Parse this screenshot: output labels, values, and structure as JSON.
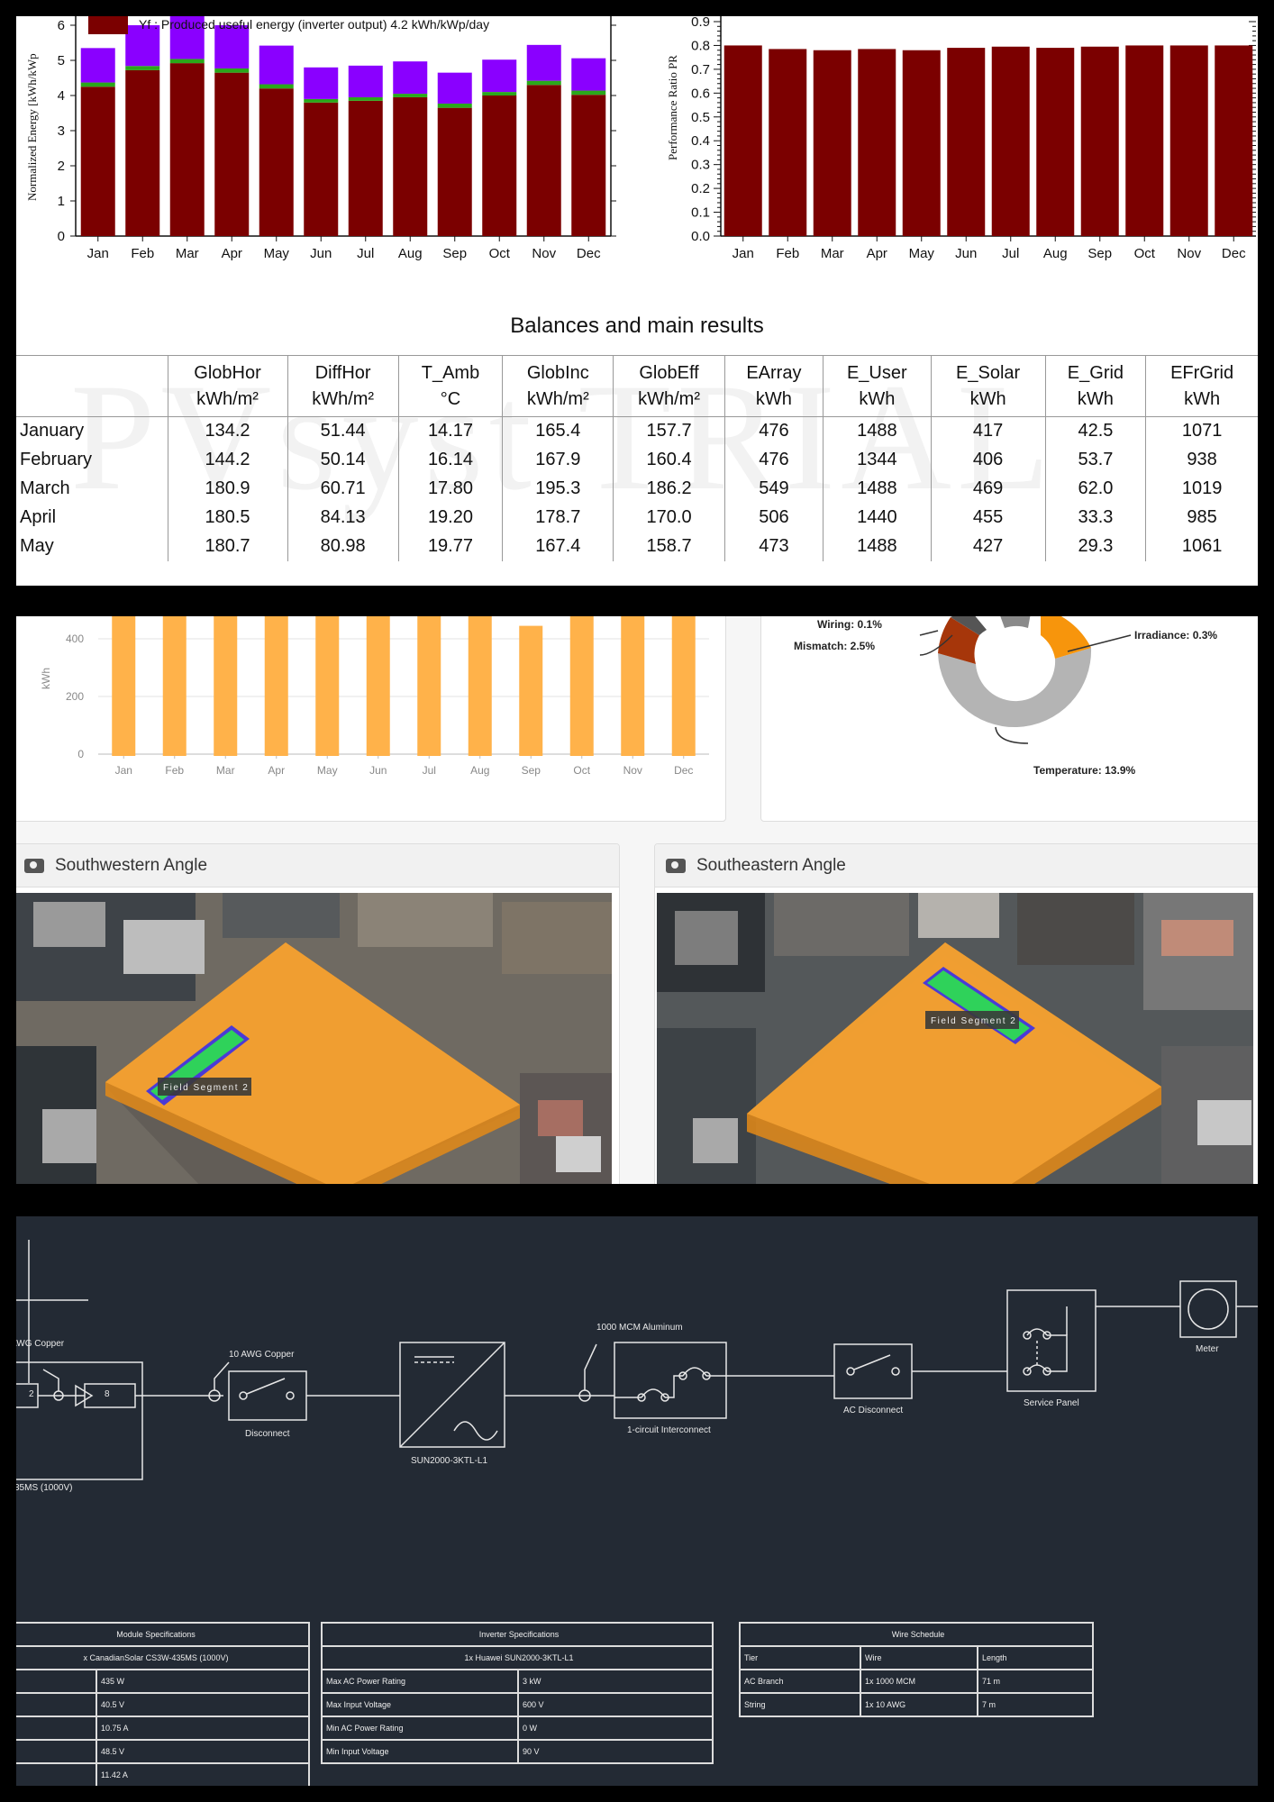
{
  "report": {
    "energy_chart": {
      "ylabel": "Normalized Energy [kWh/kWp",
      "legend_text": "Yf : Produced useful energy  (inverter output)  4.2 kWh/kWp/day",
      "months": [
        "Jan",
        "Feb",
        "Mar",
        "Apr",
        "May",
        "Jun",
        "Jul",
        "Aug",
        "Sep",
        "Oct",
        "Nov",
        "Dec"
      ],
      "y_ticks": [
        "0",
        "1",
        "2",
        "3",
        "4",
        "5",
        "6"
      ]
    },
    "pr_chart": {
      "ylabel": "Performance Ratio PR",
      "y_ticks": [
        "0.0",
        "0.1",
        "0.2",
        "0.3",
        "0.4",
        "0.5",
        "0.6",
        "0.7",
        "0.8",
        "0.9"
      ]
    },
    "table_title": "Balances and main results",
    "watermark": "PVsyst TRIAL",
    "columns": [
      "GlobHor",
      "DiffHor",
      "T_Amb",
      "GlobInc",
      "GlobEff",
      "EArray",
      "E_User",
      "E_Solar",
      "E_Grid",
      "EFrGrid"
    ],
    "units": [
      "kWh/m²",
      "kWh/m²",
      "°C",
      "kWh/m²",
      "kWh/m²",
      "kWh",
      "kWh",
      "kWh",
      "kWh",
      "kWh"
    ],
    "rows": [
      {
        "month": "January",
        "vals": [
          "134.2",
          "51.44",
          "14.17",
          "165.4",
          "157.7",
          "476",
          "1488",
          "417",
          "42.5",
          "1071"
        ]
      },
      {
        "month": "February",
        "vals": [
          "144.2",
          "50.14",
          "16.14",
          "167.9",
          "160.4",
          "476",
          "1344",
          "406",
          "53.7",
          "938"
        ]
      },
      {
        "month": "March",
        "vals": [
          "180.9",
          "60.71",
          "17.80",
          "195.3",
          "186.2",
          "549",
          "1488",
          "469",
          "62.0",
          "1019"
        ]
      },
      {
        "month": "April",
        "vals": [
          "180.5",
          "84.13",
          "19.20",
          "178.7",
          "170.0",
          "506",
          "1440",
          "455",
          "33.3",
          "985"
        ]
      },
      {
        "month": "May",
        "vals": [
          "180.7",
          "80.98",
          "19.77",
          "167.4",
          "158.7",
          "473",
          "1488",
          "427",
          "29.3",
          "1061"
        ]
      }
    ]
  },
  "chart_data": [
    {
      "type": "bar",
      "ylabel": "Normalized Energy [kWh/kWp",
      "categories": [
        "Jan",
        "Feb",
        "Mar",
        "Apr",
        "May",
        "Jun",
        "Jul",
        "Aug",
        "Sep",
        "Oct",
        "Nov",
        "Dec"
      ],
      "series": [
        {
          "name": "Yf : Produced useful energy (inverter output) 4.2 kWh/kWp/day",
          "values": [
            4.25,
            4.72,
            4.92,
            4.65,
            4.2,
            3.8,
            3.85,
            3.95,
            3.65,
            4.0,
            4.3,
            4.02
          ],
          "color": "#7b0000"
        },
        {
          "series_role": "green band",
          "values": [
            0.12,
            0.12,
            0.12,
            0.12,
            0.12,
            0.1,
            0.1,
            0.1,
            0.12,
            0.1,
            0.12,
            0.12
          ],
          "color": "#2aa81a"
        },
        {
          "series_role": "purple band",
          "values": [
            0.98,
            1.16,
            1.3,
            1.23,
            1.1,
            0.9,
            0.9,
            0.92,
            0.88,
            0.92,
            1.02,
            0.92
          ],
          "color": "#8a00ff"
        }
      ],
      "ylim": [
        0,
        6
      ]
    },
    {
      "type": "bar",
      "ylabel": "Performance Ratio PR",
      "categories": [
        "Jan",
        "Feb",
        "Mar",
        "Apr",
        "May",
        "Jun",
        "Jul",
        "Aug",
        "Sep",
        "Oct",
        "Nov",
        "Dec"
      ],
      "values": [
        0.8,
        0.785,
        0.78,
        0.785,
        0.78,
        0.79,
        0.795,
        0.79,
        0.795,
        0.8,
        0.8,
        0.8
      ],
      "ylim": [
        0,
        0.9
      ]
    },
    {
      "type": "bar",
      "ylabel": "kWh",
      "categories": [
        "Jan",
        "Feb",
        "Mar",
        "Apr",
        "May",
        "Jun",
        "Jul",
        "Aug",
        "Sep",
        "Oct",
        "Nov",
        "Dec"
      ],
      "values": [
        530,
        530,
        530,
        530,
        530,
        500,
        505,
        505,
        445,
        510,
        530,
        530
      ],
      "ylim": [
        0,
        500
      ],
      "y_ticks": [
        "0",
        "200",
        "400"
      ]
    },
    {
      "type": "pie",
      "labels": [
        "Wiring: 0.1%",
        "Mismatch: 2.5%",
        "Irradiance: 0.3%",
        "Temperature: 13.9%"
      ]
    }
  ],
  "dashboard": {
    "photo_left_title": "Southwestern Angle",
    "photo_right_title": "Southeastern Angle",
    "field_label": "Field Segment 2"
  },
  "sld": {
    "copper_left": "AWG Copper",
    "copper_10": "10 AWG Copper",
    "disconnect": "Disconnect",
    "inverter": "SUN2000-3KTL-L1",
    "mcm": "1000 MCM Aluminum",
    "interconnect": "1-circuit Interconnect",
    "ac_disconnect": "AC Disconnect",
    "service_panel": "Service Panel",
    "meter": "Meter",
    "module_bottom": "35MS (1000V)",
    "box_left": "2",
    "box_right": "8",
    "module_spec": {
      "title": "Module Specifications",
      "model": "x CanadianSolar CS3W-435MS (1000V)",
      "values": [
        "435 W",
        "40.5 V",
        "10.75 A",
        "48.5 V",
        "11.42 A"
      ]
    },
    "inverter_spec": {
      "title": "Inverter Specifications",
      "model": "1x Huawei SUN2000-3KTL-L1",
      "rows": [
        {
          "k": "Max AC Power Rating",
          "v": "3 kW"
        },
        {
          "k": "Max Input Voltage",
          "v": "600 V"
        },
        {
          "k": "Min AC Power Rating",
          "v": "0 W"
        },
        {
          "k": "Min Input Voltage",
          "v": "90 V"
        }
      ]
    },
    "wire_schedule": {
      "title": "Wire Schedule",
      "head": [
        "Tier",
        "Wire",
        "Length"
      ],
      "rows": [
        {
          "a": "AC Branch",
          "b": "1x 1000 MCM",
          "c": "71 m"
        },
        {
          "a": "String",
          "b": "1x 10 AWG",
          "c": "7 m"
        }
      ]
    }
  }
}
